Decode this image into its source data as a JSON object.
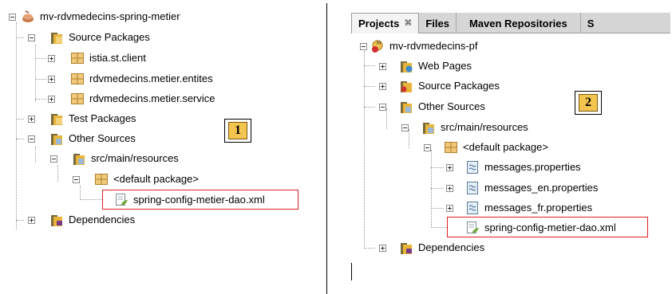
{
  "panel1": {
    "tree": {
      "project": "mv-rdvmedecins-spring-metier",
      "source_packages": "Source Packages",
      "pkg_client": "istia.st.client",
      "pkg_entites": "rdvmedecins.metier.entites",
      "pkg_service": "rdvmedecins.metier.service",
      "test_packages": "Test Packages",
      "other_sources": "Other Sources",
      "resources": "src/main/resources",
      "default_package": "<default package>",
      "xml_file": "spring-config-metier-dao.xml",
      "dependencies": "Dependencies"
    },
    "callout": "1"
  },
  "panel2": {
    "tabs": [
      {
        "label": "Projects",
        "close": "⌘"
      },
      {
        "label": "Files"
      },
      {
        "label": "Maven Repositories"
      },
      {
        "label": "S"
      }
    ],
    "tree": {
      "project": "mv-rdvmedecins-pf",
      "web_pages": "Web Pages",
      "source_packages": "Source Packages",
      "other_sources": "Other Sources",
      "resources": "src/main/resources",
      "default_package": "<default package>",
      "messages": "messages.properties",
      "messages_en": "messages_en.properties",
      "messages_fr": "messages_fr.properties",
      "xml_file": "spring-config-metier-dao.xml",
      "dependencies": "Dependencies"
    },
    "callout": "2"
  },
  "colors": {
    "highlight": "#e02020",
    "callout_fill": "#f3c44e",
    "folder": "#e8b53a",
    "package": "#e2b05a"
  },
  "icons": [
    "maven-project-icon",
    "folder-icon",
    "package-icon",
    "properties-file-icon",
    "xml-config-file-icon",
    "dependencies-icon",
    "web-folder-icon"
  ]
}
